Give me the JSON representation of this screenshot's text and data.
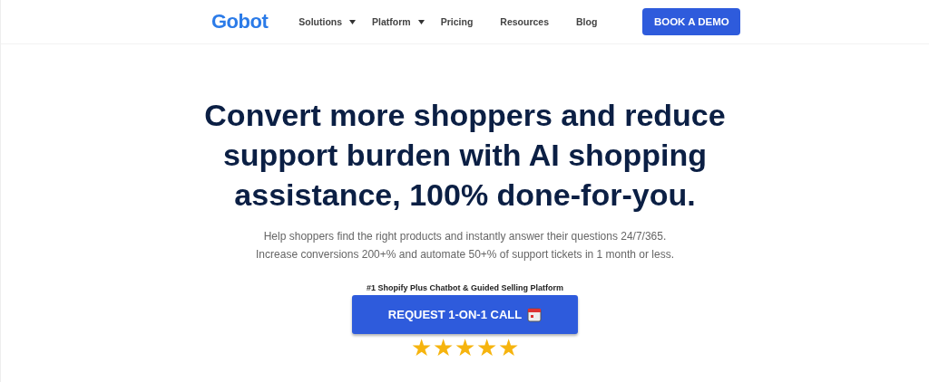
{
  "nav": {
    "logo": "Gobot",
    "items": [
      {
        "label": "Solutions",
        "dropdown": true
      },
      {
        "label": "Platform",
        "dropdown": true
      },
      {
        "label": "Pricing",
        "dropdown": false
      },
      {
        "label": "Resources",
        "dropdown": false
      },
      {
        "label": "Blog",
        "dropdown": false
      }
    ],
    "cta": "BOOK A DEMO"
  },
  "hero": {
    "headline": "Convert more shoppers and reduce support burden with AI shopping assistance, 100% done-for-you.",
    "subtext": [
      "Help shoppers find the right products and instantly answer their questions 24/7/365.",
      "Increase conversions 200+% and automate 50+% of support tickets in 1 month or less."
    ],
    "tagline": "#1 Shopify Plus Chatbot & Guided Selling Platform",
    "button": "REQUEST 1-ON-1 CALL",
    "stars": 5
  }
}
